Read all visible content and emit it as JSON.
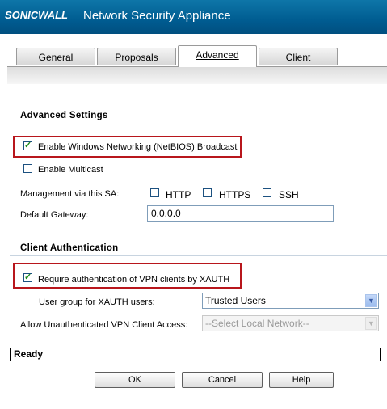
{
  "header": {
    "logo_text": "SONICWALL",
    "title": "Network Security Appliance"
  },
  "tabs": [
    {
      "label": "General"
    },
    {
      "label": "Proposals"
    },
    {
      "label": "Advanced",
      "active": true
    },
    {
      "label": "Client"
    }
  ],
  "advanced_settings": {
    "title": "Advanced Settings",
    "netbios_label": "Enable Windows Networking (NetBIOS) Broadcast",
    "netbios_checked": true,
    "multicast_label": "Enable Multicast",
    "multicast_checked": false,
    "management_label": "Management via this SA:",
    "http_label": "HTTP",
    "https_label": "HTTPS",
    "ssh_label": "SSH",
    "gateway_label": "Default Gateway:",
    "gateway_value": "0.0.0.0"
  },
  "client_auth": {
    "title": "Client Authentication",
    "xauth_label": "Require authentication of VPN clients by XAUTH",
    "xauth_checked": true,
    "user_group_label": "User group for XAUTH users:",
    "user_group_value": "Trusted Users",
    "unauth_label": "Allow Unauthenticated VPN Client Access:",
    "unauth_value": "--Select Local Network--"
  },
  "status": {
    "text": "Ready"
  },
  "buttons": {
    "ok": "OK",
    "cancel": "Cancel",
    "help": "Help"
  },
  "colors": {
    "header_blue": "#005c91",
    "highlight_red": "#b8161c"
  }
}
